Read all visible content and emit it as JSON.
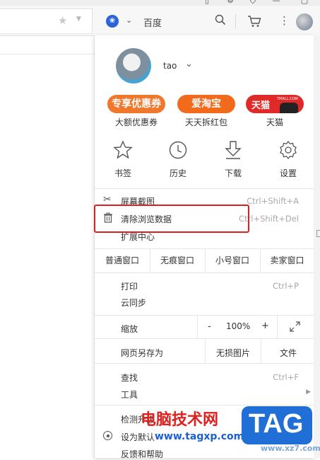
{
  "toolbar": {
    "search_engine": "百度",
    "star_icon": "star-icon",
    "search_icon": "search-icon",
    "cart_icon": "cart-icon",
    "menu_icon": "more-vertical-icon"
  },
  "user": {
    "name": "tao"
  },
  "promos": [
    {
      "tile_text": "专享优惠券",
      "label": "大额优惠券",
      "color": "#f0782d"
    },
    {
      "tile_text": "爱淘宝",
      "label": "天天拆红包",
      "color": "#f26a1b"
    },
    {
      "tile_text": "天猫",
      "label": "天猫",
      "color": "#e02a2a",
      "badge": "TMALL.COM"
    }
  ],
  "tools": [
    {
      "label": "书签",
      "icon": "bookmark-star-icon"
    },
    {
      "label": "历史",
      "icon": "clock-icon"
    },
    {
      "label": "下载",
      "icon": "download-icon"
    },
    {
      "label": "设置",
      "icon": "gear-icon"
    }
  ],
  "menu": {
    "screenshot": {
      "label": "屏幕截图",
      "shortcut": "Ctrl+Shift+A"
    },
    "clear_data": {
      "label": "清除浏览数据",
      "shortcut": "Ctrl+Shift+Del"
    },
    "extensions": {
      "label": "扩展中心"
    },
    "windows": [
      "普通窗口",
      "无痕窗口",
      "小号窗口",
      "卖家窗口"
    ],
    "print": {
      "label": "打印",
      "shortcut": "Ctrl+P"
    },
    "sync": {
      "label": "云同步"
    },
    "zoom": {
      "label": "缩放",
      "minus": "-",
      "value": "100%",
      "plus": "+"
    },
    "save_as": {
      "label": "网页另存为",
      "lossless": "无损图片",
      "file": "文件"
    },
    "find": {
      "label": "查找",
      "shortcut": "Ctrl+F"
    },
    "tools": {
      "label": "工具"
    },
    "check_update": {
      "label": "检测升级"
    },
    "set_default": {
      "label": "设为默认"
    },
    "feedback": {
      "label": "反馈和帮助"
    }
  },
  "highlight_color": "#e02020",
  "watermark": {
    "title": "电脑技术网",
    "url": "www.tagxp.com",
    "tag": "TAG",
    "site2": "www.xz7.com"
  }
}
